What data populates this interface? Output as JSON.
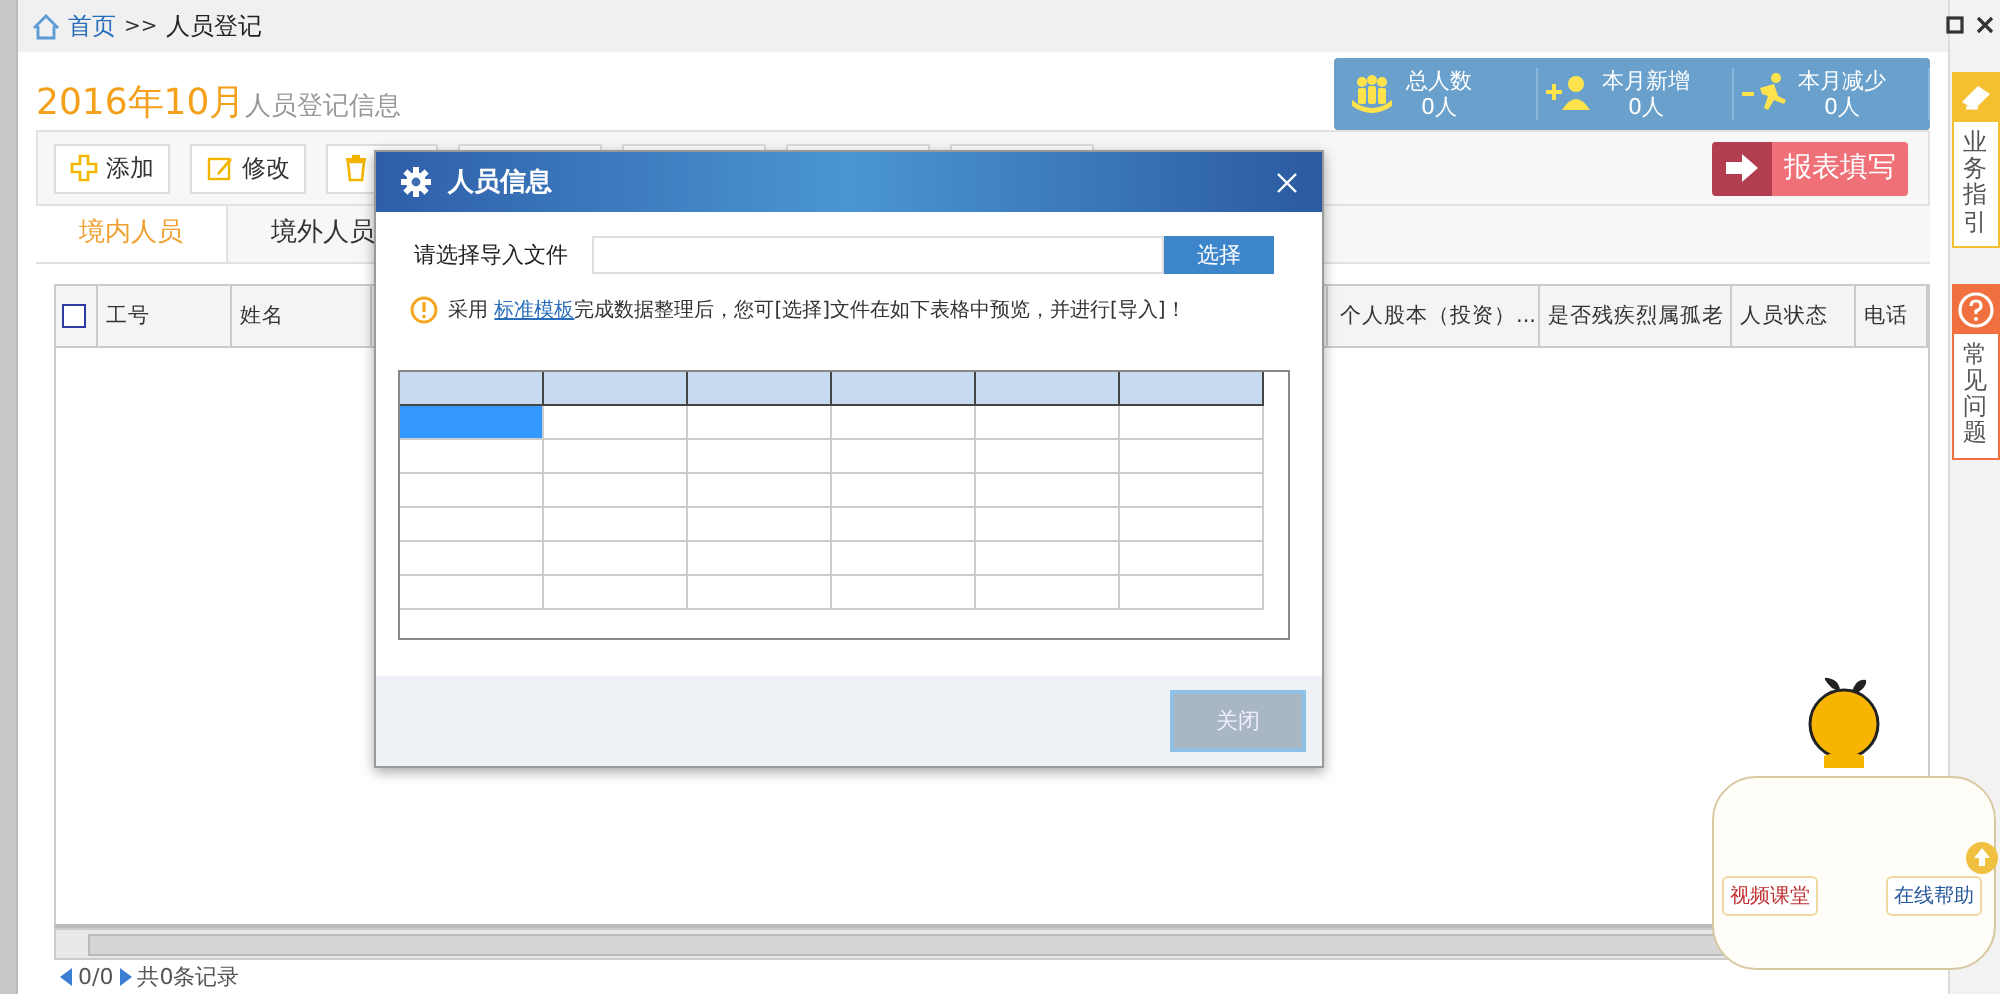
{
  "breadcrumb": {
    "home": "首页",
    "separator": ">>",
    "current": "人员登记"
  },
  "page_title": {
    "period": "2016年10月",
    "subtitle": "人员登记信息"
  },
  "stats": [
    {
      "kind": "total",
      "label": "总人数",
      "value": "0人"
    },
    {
      "kind": "added",
      "label": "本月新增",
      "value": "0人"
    },
    {
      "kind": "removed",
      "label": "本月减少",
      "value": "0人"
    }
  ],
  "toolbar": [
    {
      "kind": "add",
      "label": "添加"
    },
    {
      "kind": "edit",
      "label": "修改"
    },
    {
      "kind": "delete"
    },
    {
      "kind": "blank"
    },
    {
      "kind": "blank"
    },
    {
      "kind": "blank"
    },
    {
      "kind": "blank"
    }
  ],
  "report_button": "报表填写",
  "tabs": [
    {
      "label": "境内人员",
      "selected": true
    },
    {
      "label": "境外人员",
      "selected": false
    }
  ],
  "table": {
    "select_all_checked": false,
    "columns": [
      {
        "label": "工号"
      },
      {
        "label": "姓名"
      },
      {
        "label": "个人股本（投资）..."
      },
      {
        "label": "是否残疾烈属孤老"
      },
      {
        "label": "人员状态"
      },
      {
        "label": "电话"
      }
    ]
  },
  "pager": {
    "position": "0/0",
    "total": "共0条记录"
  },
  "side_tabs": [
    {
      "kind": "guide",
      "label": "业务指引"
    },
    {
      "kind": "faq",
      "label": "常见问题"
    }
  ],
  "help_widget": {
    "buttons": [
      "视频课堂",
      "在线帮助"
    ]
  },
  "dialog": {
    "title": "人员信息",
    "file_label": "请选择导入文件",
    "choose_button": "选择",
    "notice_before": "采用 ",
    "notice_link": "标准模板",
    "notice_after": "完成数据整理后，您可[选择]文件在如下表格中预览，并进行[导入]！",
    "close_button": {
      "label": "关闭",
      "disabled": true
    },
    "preview_rows": [
      {
        "cells": [
          {
            "selected": true
          },
          {
            "selected": false
          },
          {
            "selected": false
          },
          {
            "selected": false
          },
          {
            "selected": false
          },
          {
            "selected": false
          }
        ]
      },
      {
        "cells": [
          {
            "selected": false
          },
          {
            "selected": false
          },
          {
            "selected": false
          },
          {
            "selected": false
          },
          {
            "selected": false
          },
          {
            "selected": false
          }
        ]
      },
      {
        "cells": [
          {
            "selected": false
          },
          {
            "selected": false
          },
          {
            "selected": false
          },
          {
            "selected": false
          },
          {
            "selected": false
          },
          {
            "selected": false
          }
        ]
      },
      {
        "cells": [
          {
            "selected": false
          },
          {
            "selected": false
          },
          {
            "selected": false
          },
          {
            "selected": false
          },
          {
            "selected": false
          },
          {
            "selected": false
          }
        ]
      },
      {
        "cells": [
          {
            "selected": false
          },
          {
            "selected": false
          },
          {
            "selected": false
          },
          {
            "selected": false
          },
          {
            "selected": false
          },
          {
            "selected": false
          }
        ]
      },
      {
        "cells": [
          {
            "selected": false
          },
          {
            "selected": false
          },
          {
            "selected": false
          },
          {
            "selected": false
          },
          {
            "selected": false
          },
          {
            "selected": false
          }
        ]
      }
    ]
  }
}
